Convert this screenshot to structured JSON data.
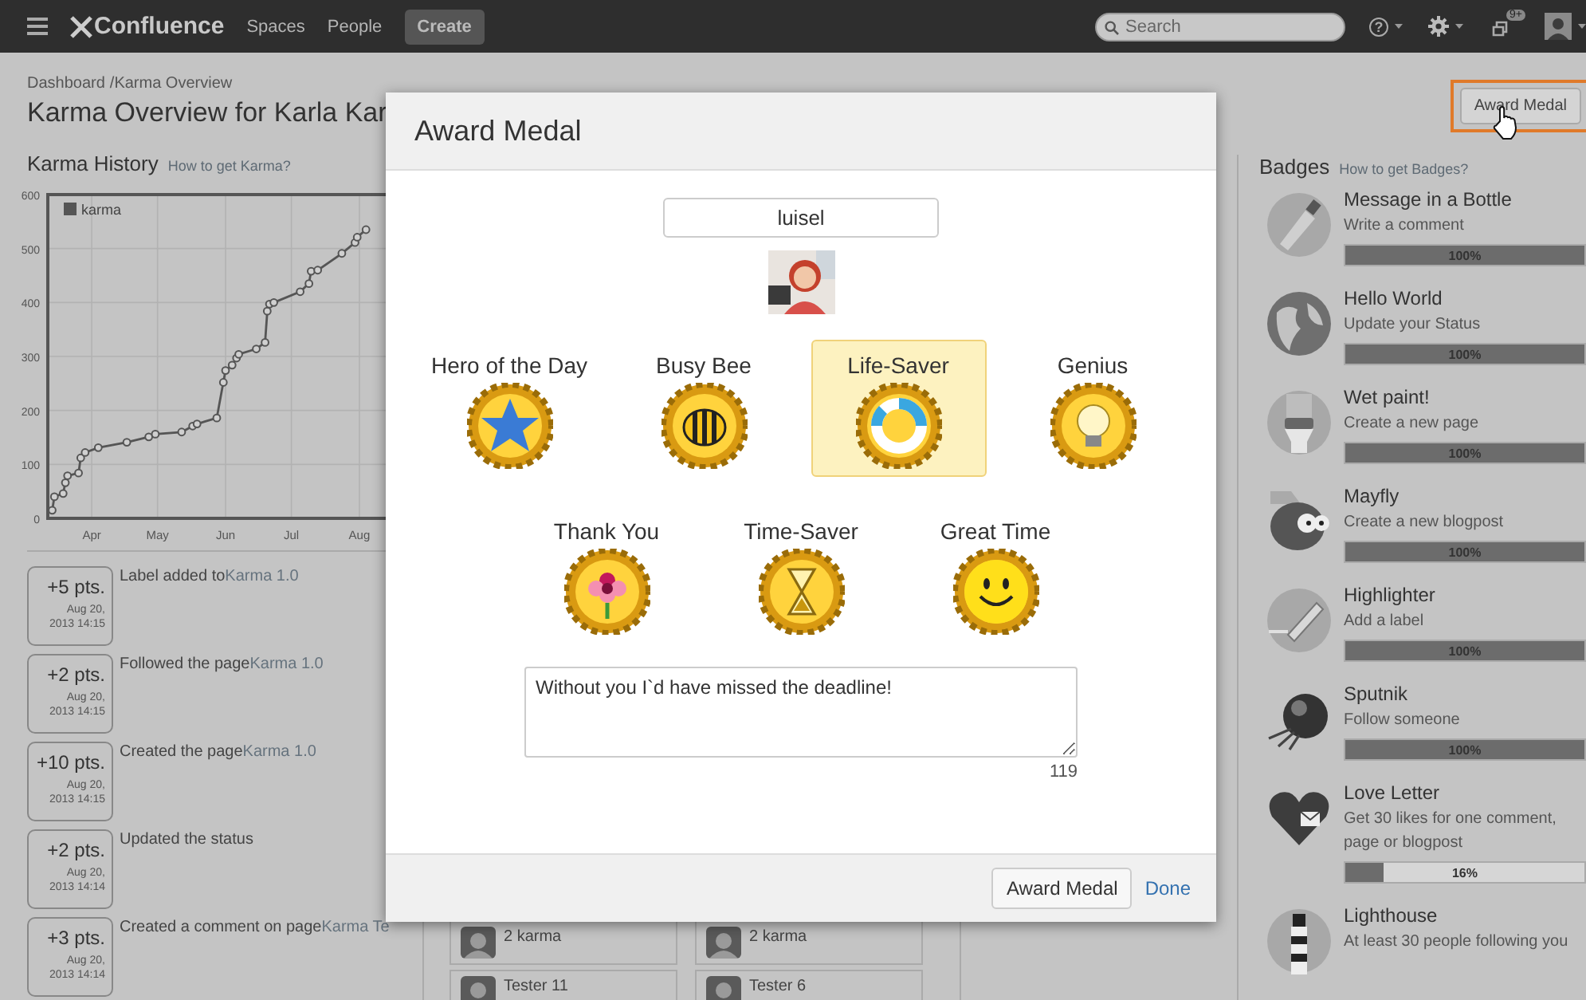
{
  "nav": {
    "logo": "Confluence",
    "links": [
      "Spaces",
      "People"
    ],
    "create": "Create",
    "search_placeholder": "Search",
    "help": "?",
    "notifications": "9+"
  },
  "breadcrumb": [
    "Dashboard",
    "/Karma Overview"
  ],
  "title": "Karma Overview for Karla Kar",
  "award_button": "Award Medal",
  "karma_history": {
    "title": "Karma History",
    "help_link": "How to get Karma?",
    "chart_data": {
      "type": "line",
      "x": [
        "2013-03-14",
        "2013-03-15",
        "2013-03-19",
        "2013-03-20",
        "2013-03-21",
        "2013-03-26",
        "2013-03-27",
        "2013-03-29",
        "2013-04-04",
        "2013-04-17",
        "2013-04-27",
        "2013-04-30",
        "2013-05-12",
        "2013-05-17",
        "2013-05-19",
        "2013-05-28",
        "2013-05-31",
        "2013-06-01",
        "2013-06-04",
        "2013-06-06",
        "2013-06-07",
        "2013-06-15",
        "2013-06-19",
        "2013-06-20",
        "2013-06-21",
        "2013-06-23",
        "2013-07-05",
        "2013-07-09",
        "2013-07-10",
        "2013-07-13",
        "2013-07-24",
        "2013-07-30",
        "2013-07-31",
        "2013-08-04"
      ],
      "series": [
        {
          "name": "karma",
          "color": "#555555",
          "marker": true,
          "values": [
            15,
            40,
            46,
            66,
            79,
            84,
            112,
            122,
            131,
            141,
            151,
            156,
            160,
            171,
            175,
            186,
            252,
            274,
            284,
            297,
            304,
            314,
            326,
            384,
            397,
            400,
            420,
            435,
            458,
            460,
            491,
            511,
            521,
            535
          ]
        }
      ],
      "xlim": [
        "2013-03-12",
        "2013-08-13"
      ],
      "ylim": [
        0,
        600
      ],
      "grid": true,
      "xticks": [
        {
          "value": "2013-04-01",
          "label": "Apr"
        },
        {
          "value": "2013-05-01",
          "label": "May"
        },
        {
          "value": "2013-06-01",
          "label": "Jun"
        },
        {
          "value": "2013-07-01",
          "label": "Jul"
        },
        {
          "value": "2013-08-01",
          "label": "Aug"
        }
      ],
      "yticks": [
        0,
        100,
        200,
        300,
        400,
        500,
        600
      ]
    }
  },
  "activity": [
    {
      "points": "+5 pts.",
      "date": "Aug 20,",
      "time": "2013 14:15",
      "text": "Label added to",
      "link": "Karma 1.0"
    },
    {
      "points": "+2 pts.",
      "date": "Aug 20,",
      "time": "2013 14:15",
      "text": "Followed the page",
      "link": "Karma 1.0"
    },
    {
      "points": "+10 pts.",
      "date": "Aug 20,",
      "time": "2013 14:15",
      "text": "Created the page",
      "link": "Karma 1.0"
    },
    {
      "points": "+2 pts.",
      "date": "Aug 20,",
      "time": "2013 14:14",
      "text": "Updated the status"
    },
    {
      "points": "+3 pts.",
      "date": "Aug 20,",
      "time": "2013 14:14",
      "text": "Created a comment on page",
      "link": "Karma Te"
    }
  ],
  "people": [
    [
      {
        "name": "2 karma"
      },
      {
        "name": "2 karma"
      }
    ],
    [
      {
        "name": "Tester 11"
      },
      {
        "name": "Tester 6"
      }
    ]
  ],
  "badges": {
    "title": "Badges",
    "help_link": "How to get Badges?",
    "items": [
      {
        "name": "Message in a Bottle",
        "description": "Write a comment",
        "level": 1,
        "reading": "100%"
      },
      {
        "name": "Hello World",
        "description": "Update your Status",
        "level": 1,
        "reading": "100%"
      },
      {
        "name": "Wet paint!",
        "description": "Create a new page",
        "level": 1,
        "reading": "100%"
      },
      {
        "name": "Mayfly",
        "description": "Create a new blogpost",
        "level": 1,
        "reading": "100%"
      },
      {
        "name": "Highlighter",
        "description": "Add a label",
        "level": 1,
        "reading": "100%"
      },
      {
        "name": "Sputnik",
        "description": "Follow someone",
        "level": 1,
        "reading": "100%"
      },
      {
        "name": "Love Letter",
        "description": "Get 30 likes for one comment, page or blogpost",
        "level": 0.16,
        "reading": "16%"
      },
      {
        "name": "Lighthouse",
        "description": "At least 30 people following you"
      }
    ]
  },
  "dialog": {
    "title": "Award Medal",
    "recipient": "luisel",
    "medal_rows": [
      {
        "medals": [
          {
            "label": "Hero of the Day",
            "selected": false
          },
          {
            "label": "Busy Bee",
            "selected": false
          },
          {
            "label": "Life-Saver",
            "selected": true
          },
          {
            "label": "Genius",
            "selected": false
          }
        ]
      },
      {
        "medals": [
          {
            "label": "Thank You",
            "selected": false
          },
          {
            "label": "Time-Saver",
            "selected": false
          },
          {
            "label": "Great Time",
            "selected": false
          }
        ]
      }
    ],
    "message": "Without you I`d have missed the deadline!",
    "counter": "119",
    "buttons": {
      "primary": "Award Medal",
      "link": "Done"
    }
  }
}
